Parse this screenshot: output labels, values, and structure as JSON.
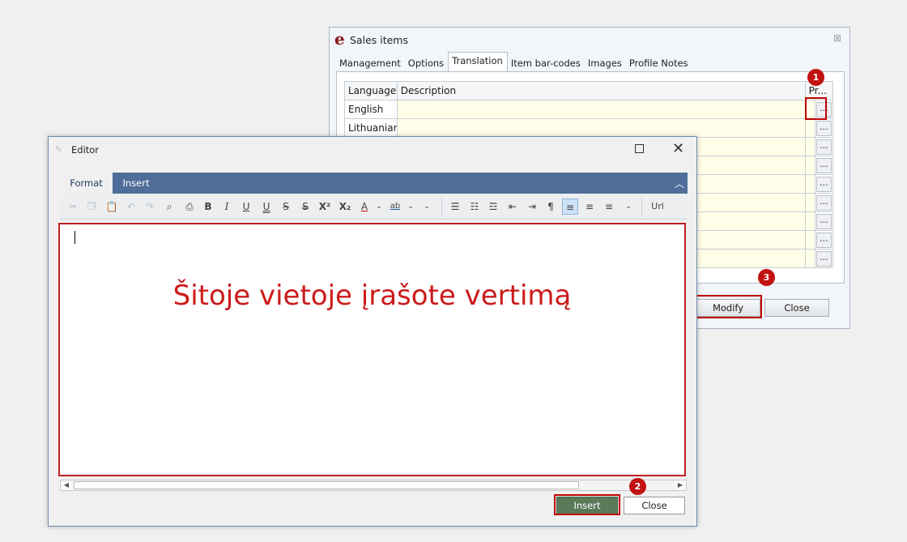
{
  "sales_window": {
    "title": "Sales items",
    "icon_letter": "e",
    "close_glyph": "⊠",
    "tabs": [
      {
        "label": "Management"
      },
      {
        "label": "Options"
      },
      {
        "label": "Translation"
      },
      {
        "label": "Item bar-codes"
      },
      {
        "label": "Images"
      },
      {
        "label": "Profile Notes"
      }
    ],
    "active_tab": "Translation",
    "grid": {
      "headers": {
        "language": "Language",
        "description": "Description",
        "profile": "Pr..."
      },
      "rows": [
        {
          "language": "English",
          "description": ""
        },
        {
          "language": "Lithuanian",
          "description": ""
        },
        {
          "language": "",
          "description": ""
        },
        {
          "language": "",
          "description": ""
        },
        {
          "language": "",
          "description": ""
        },
        {
          "language": "",
          "description": ""
        },
        {
          "language": "",
          "description": ""
        },
        {
          "language": "",
          "description": ""
        },
        {
          "language": "",
          "description": ""
        }
      ],
      "row_button_label": "..."
    },
    "buttons": {
      "modify": "Modify",
      "close": "Close"
    }
  },
  "editor_window": {
    "title": "Editor",
    "ribbon_tabs": [
      {
        "label": "Format"
      },
      {
        "label": "Insert"
      }
    ],
    "active_ribbon_tab": "Format",
    "toolbar": {
      "bold": "B",
      "italic": "I",
      "underline": "U",
      "double_underline": "U",
      "strike": "S",
      "double_strike": "S",
      "superscript": "X²",
      "subscript": "X₂",
      "font_color": "A",
      "highlight": "ab",
      "url": "Url"
    },
    "overlay_annotation": "Šitoje vietoje įrašote vertimą",
    "buttons": {
      "insert": "Insert",
      "close": "Close"
    }
  },
  "markers": [
    "1",
    "2",
    "3"
  ],
  "colors": {
    "ribbon": "#4f6d99",
    "highlight_red": "#c00000",
    "insert_button": "#5a7a5a",
    "description_cell": "#fffee8"
  }
}
